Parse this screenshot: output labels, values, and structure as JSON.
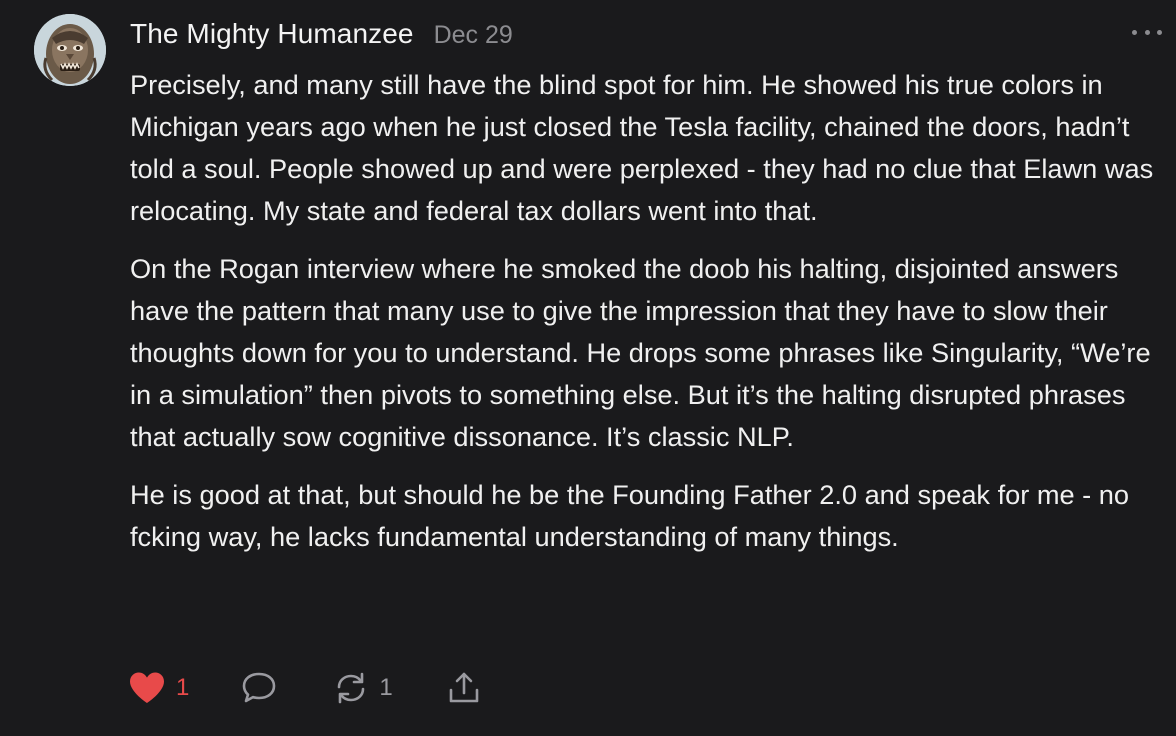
{
  "comment": {
    "author": "The Mighty Humanzee",
    "date": "Dec 29",
    "paragraphs": [
      "Precisely, and many still have the blind spot for him. He showed his true colors in Michigan years ago when he just closed the Tesla facility, chained the doors, hadn’t told a soul. People showed up and were perplexed - they had no clue that Elawn was relocating. My state and federal tax dollars went into that.",
      "On the Rogan interview where he smoked the doob his halting, disjointed answers have the pattern that many use to give the impression that they have to slow their thoughts down for you to understand. He drops some phrases like Singularity, “We’re in a simulation” then pivots to something else. But it’s the halting disrupted phrases that actually sow cognitive dissonance. It’s classic NLP.",
      "He is good at that, but should he be the Founding Father 2.0 and speak for me - no fcking way, he lacks fundamental understanding of many things."
    ]
  },
  "actions": {
    "like_count": "1",
    "restack_count": "1"
  },
  "icons": {
    "avatar": "avatar-image",
    "more": "more-horizontal-icon",
    "like": "heart-filled-icon",
    "comment": "comment-bubble-icon",
    "restack": "restack-arrows-icon",
    "share": "share-upload-icon"
  },
  "colors": {
    "background": "#1a1a1c",
    "text": "#f0f0f0",
    "muted": "#8c8c90",
    "like": "#e84a4a"
  }
}
